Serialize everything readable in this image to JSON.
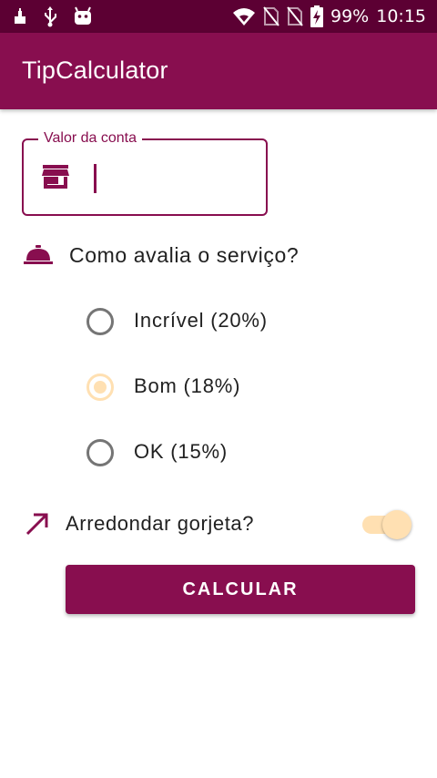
{
  "status_bar": {
    "battery_percent": "99%",
    "time": "10:15",
    "icons": [
      "notification-icon",
      "usb-icon",
      "android-icon",
      "wifi-icon",
      "no-sim-icon",
      "no-sim-icon",
      "battery-charging-icon"
    ]
  },
  "app_bar": {
    "title": "TipCalculator",
    "color": "#880e4f"
  },
  "bill_input": {
    "label": "Valor da conta",
    "value": "",
    "icon": "store-icon"
  },
  "service": {
    "question": "Como avalia o serviço?",
    "icon": "room-service-icon",
    "options": [
      {
        "label": "Incrível (20%)",
        "selected": false
      },
      {
        "label": "Bom (18%)",
        "selected": true
      },
      {
        "label": "OK (15%)",
        "selected": false
      }
    ]
  },
  "round_up": {
    "label": "Arredondar gorjeta?",
    "icon": "trending-up-arrow-icon",
    "enabled": true
  },
  "calculate_button": {
    "label": "CALCULAR"
  },
  "colors": {
    "primary": "#880e4f",
    "primary_dark": "#5c0033",
    "accent": "#ffe0b2"
  }
}
